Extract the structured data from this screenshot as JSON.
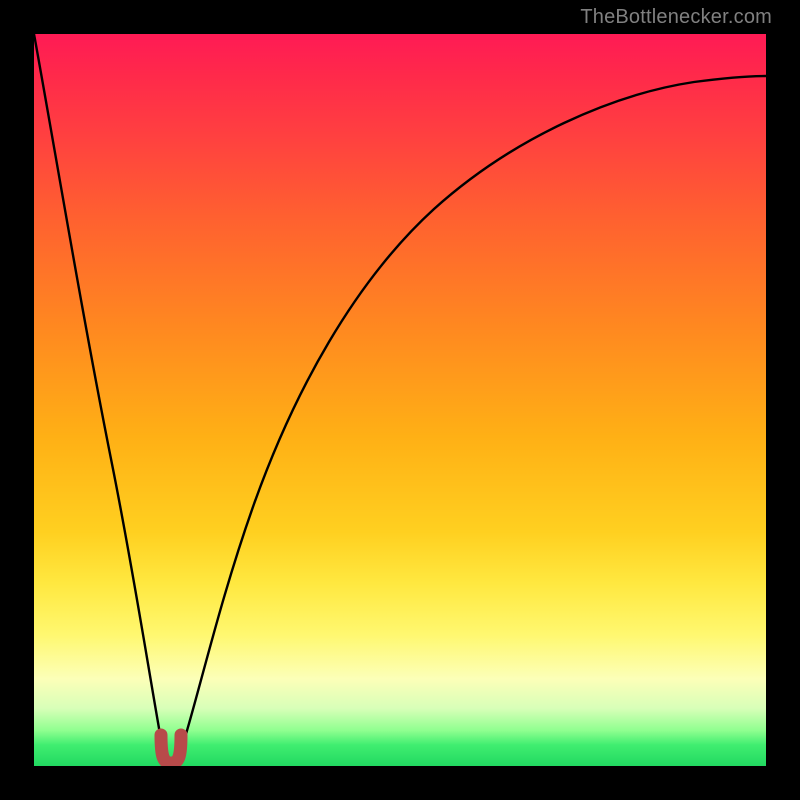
{
  "attribution": "TheBottlenecker.com",
  "chart_data": {
    "type": "line",
    "title": "",
    "xlabel": "",
    "ylabel": "",
    "xlim": [
      0,
      100
    ],
    "ylim": [
      0,
      100
    ],
    "series": [
      {
        "name": "bottleneck-curve",
        "x": [
          0,
          4,
          8,
          12,
          14,
          16,
          17,
          18,
          19,
          20,
          22,
          25,
          30,
          36,
          44,
          54,
          66,
          80,
          90,
          100
        ],
        "values": [
          100,
          80,
          58,
          34,
          21,
          10,
          5,
          2,
          2,
          5,
          14,
          28,
          44,
          58,
          70,
          79,
          86,
          91,
          93,
          94
        ]
      }
    ],
    "annotations": [
      {
        "name": "minimum-marker",
        "x": 18.5,
        "y": 2,
        "shape": "u",
        "color": "#b84a4a"
      }
    ],
    "background_gradient": {
      "top": "#ff1a55",
      "bottom": "#20d860"
    }
  }
}
